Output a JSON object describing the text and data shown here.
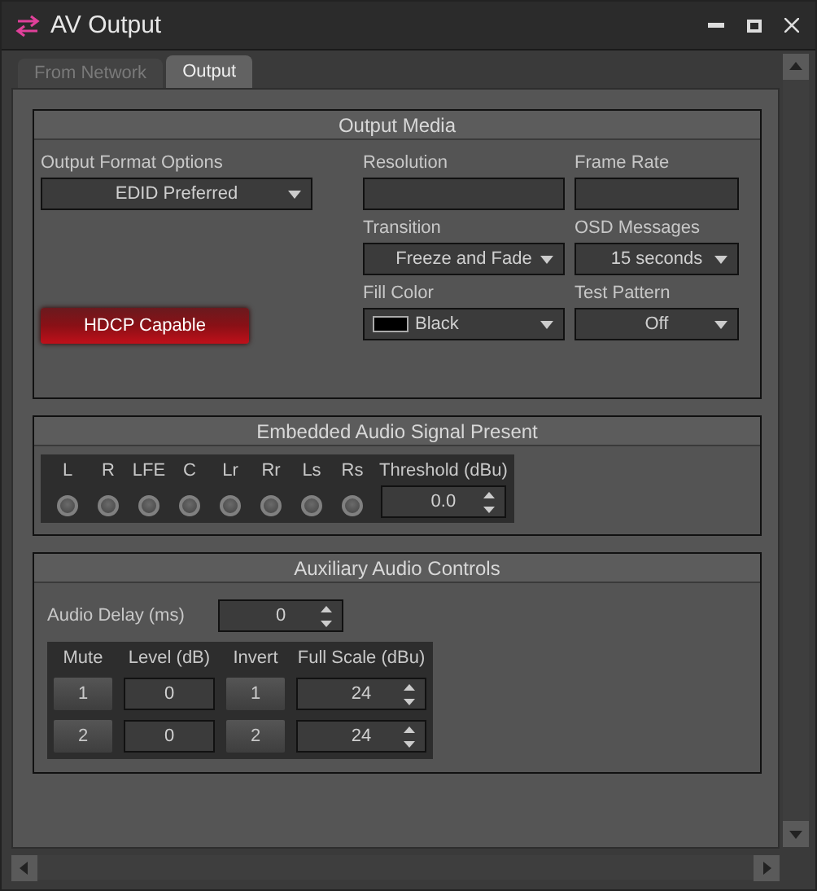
{
  "window": {
    "title": "AV Output"
  },
  "tabs": [
    {
      "label": "From Network",
      "selected": false
    },
    {
      "label": "Output",
      "selected": true
    }
  ],
  "output_media": {
    "title": "Output Media",
    "format": {
      "label": "Output Format Options",
      "value": "EDID Preferred"
    },
    "resolution": {
      "label": "Resolution"
    },
    "frame_rate": {
      "label": "Frame Rate"
    },
    "transition": {
      "label": "Transition",
      "value": "Freeze and Fade"
    },
    "osd": {
      "label": "OSD Messages",
      "value": "15 seconds"
    },
    "hdcp": {
      "label": "HDCP Capable",
      "on": true
    },
    "fill_color": {
      "label": "Fill Color",
      "value": "Black"
    },
    "test_pattern": {
      "label": "Test Pattern",
      "value": "Off"
    }
  },
  "embedded_audio": {
    "title": "Embedded Audio Signal Present",
    "channels": [
      {
        "label": "L",
        "on": false
      },
      {
        "label": "R",
        "on": false
      },
      {
        "label": "LFE",
        "on": false
      },
      {
        "label": "C",
        "on": false
      },
      {
        "label": "Lr",
        "on": false
      },
      {
        "label": "Rr",
        "on": false
      },
      {
        "label": "Ls",
        "on": false
      },
      {
        "label": "Rs",
        "on": false
      }
    ],
    "threshold": {
      "label": "Threshold (dBu)",
      "value": "0.0"
    }
  },
  "aux_audio": {
    "title": "Auxiliary Audio Controls",
    "delay": {
      "label": "Audio Delay (ms)",
      "value": "0"
    },
    "columns": [
      "Mute",
      "Level (dB)",
      "Invert",
      "Full Scale (dBu)"
    ],
    "rows": [
      {
        "mute": "1",
        "level": "0",
        "invert": "1",
        "full_scale": "24"
      },
      {
        "mute": "2",
        "level": "0",
        "invert": "2",
        "full_scale": "24"
      }
    ]
  }
}
